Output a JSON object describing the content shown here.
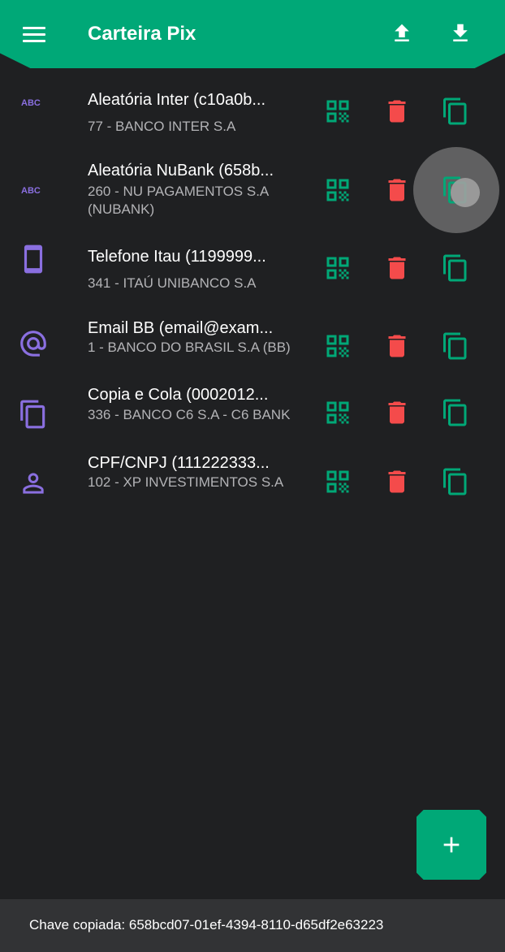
{
  "app": {
    "title": "Carteira Pix",
    "accent_color": "#00a877",
    "background_color": "#1f2022",
    "type_icon_color": "#8a6fe0",
    "qr_icon_color": "#00a877",
    "delete_icon_color": "#f44b4b",
    "copy_icon_color": "#00a877"
  },
  "toolbar": {
    "menu_icon": "menu-icon",
    "upload_icon": "upload-icon",
    "download_icon": "download-icon"
  },
  "keys": [
    {
      "type_icon": "abc-icon",
      "title": "Aleatória Inter (c10a0b...",
      "subtitle": "77 - BANCO INTER S.A"
    },
    {
      "type_icon": "abc-icon",
      "title": "Aleatória NuBank (658b...",
      "subtitle": "260 - NU PAGAMENTOS S.A (NUBANK)"
    },
    {
      "type_icon": "phone-icon",
      "title": "Telefone Itau (1199999...",
      "subtitle": "341 - ITAÚ UNIBANCO S.A"
    },
    {
      "type_icon": "at-icon",
      "title": "Email BB (email@exam...",
      "subtitle": "1 - BANCO DO BRASIL S.A (BB)"
    },
    {
      "type_icon": "copy-icon",
      "title": "Copia e Cola (0002012...",
      "subtitle": "336 - BANCO C6 S.A - C6 BANK"
    },
    {
      "type_icon": "person-icon",
      "title": "CPF/CNPJ (111222333...",
      "subtitle": "102 - XP INVESTIMENTOS S.A"
    }
  ],
  "fab": {
    "icon": "plus-icon"
  },
  "snackbar": {
    "text": "Chave copiada: 658bcd07-01ef-4394-8110-d65df2e63223"
  }
}
